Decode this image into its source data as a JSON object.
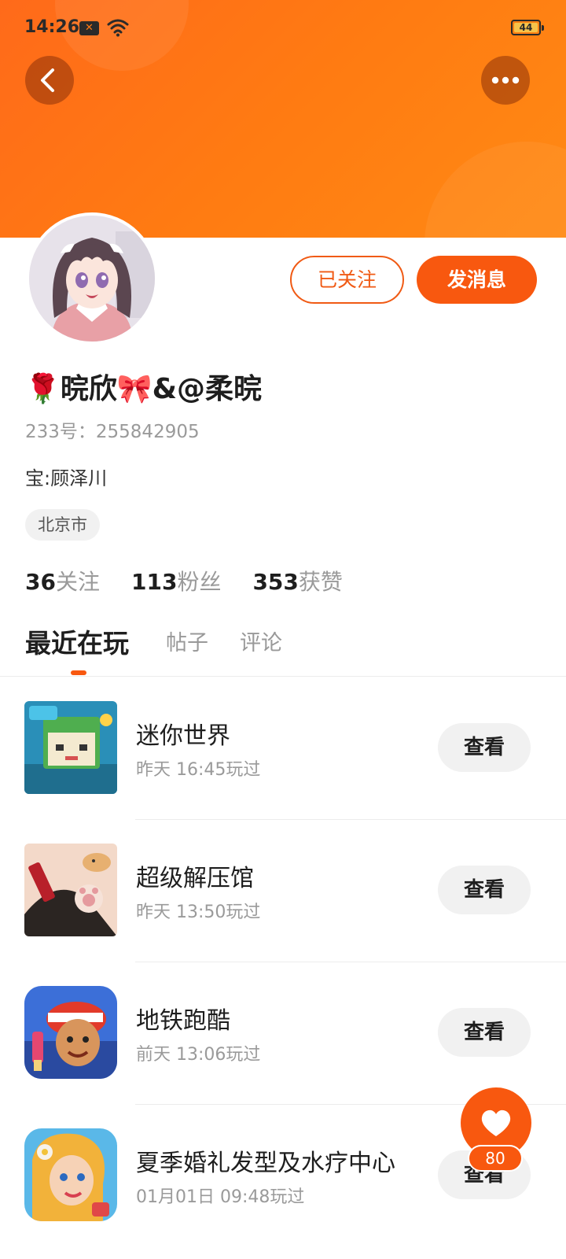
{
  "status_bar": {
    "time": "14:26",
    "notification_icon": "close-box-icon",
    "wifi_icon": "wifi-icon",
    "battery": "44"
  },
  "header": {
    "back_icon": "chevron-left-icon",
    "more_icon": "more-dots-icon",
    "accent_color": "#f8580f"
  },
  "profile": {
    "avatar_icon": "anime-girl-avatar",
    "follow_label": "已关注",
    "message_label": "发消息",
    "name": "🌹晥欣🎀&@柔晥",
    "uid": "233号：255842905",
    "bio": "宝:顾泽川",
    "location": "北京市",
    "stats": [
      {
        "num": "36",
        "label": "关注"
      },
      {
        "num": "113",
        "label": "粉丝"
      },
      {
        "num": "353",
        "label": "获赞"
      }
    ]
  },
  "tabs": [
    {
      "label": "最近在玩",
      "active": true
    },
    {
      "label": "帖子",
      "active": false
    },
    {
      "label": "评论",
      "active": false
    }
  ],
  "games": [
    {
      "name": "迷你世界",
      "time": "昨天 16:45玩过",
      "button": "查看",
      "icon": "mini-world-icon"
    },
    {
      "name": "超级解压馆",
      "time": "昨天 13:50玩过",
      "button": "查看",
      "icon": "relax-hall-icon"
    },
    {
      "name": "地铁跑酷",
      "time": "前天 13:06玩过",
      "button": "查看",
      "icon": "subway-surfers-icon"
    },
    {
      "name": "夏季婚礼发型及水疗中心",
      "time": "01月01日 09:48玩过",
      "button": "查看",
      "icon": "wedding-salon-icon"
    }
  ],
  "like": {
    "icon": "heart-icon",
    "count": "80"
  }
}
